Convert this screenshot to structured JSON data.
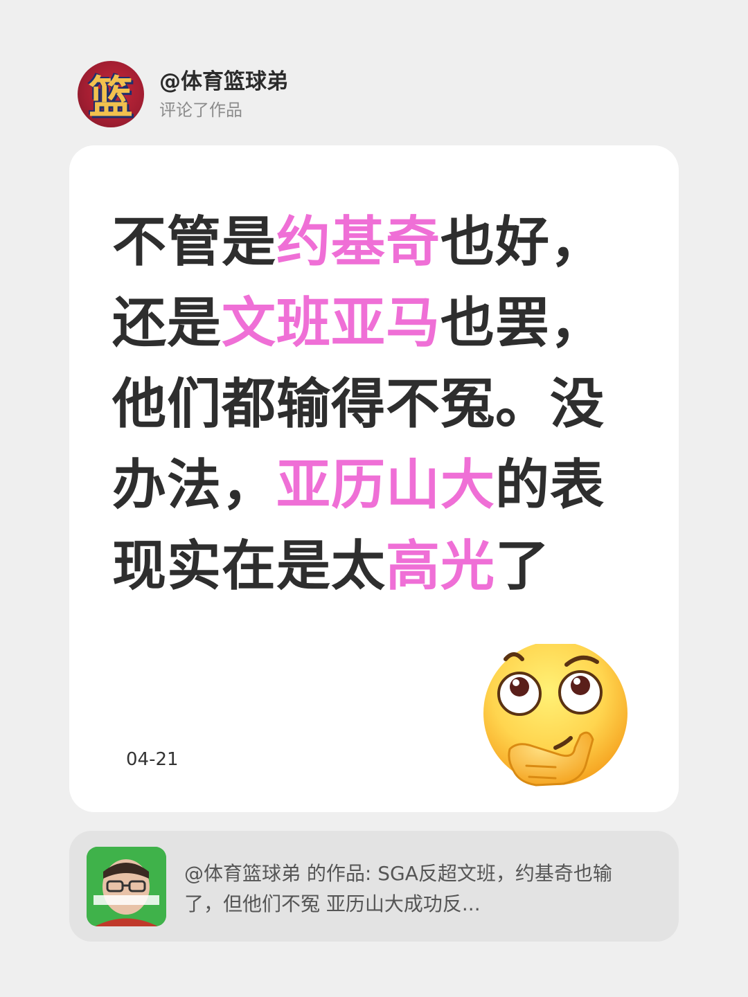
{
  "header": {
    "username": "@体育篮球弟",
    "action": "评论了作品",
    "avatar_glyph": "篮"
  },
  "comment": {
    "segments": [
      {
        "text": "不管是",
        "highlight": false
      },
      {
        "text": "约基奇",
        "highlight": true
      },
      {
        "text": "也好，还是",
        "highlight": false
      },
      {
        "text": "文班亚马",
        "highlight": true
      },
      {
        "text": "也罢，他们都输得不冤。没办法，",
        "highlight": false
      },
      {
        "text": "亚历山大",
        "highlight": true
      },
      {
        "text": "的表现实在是太",
        "highlight": false
      },
      {
        "text": "高光",
        "highlight": true
      },
      {
        "text": "了",
        "highlight": false
      }
    ],
    "highlight_color": "#ef6fd6",
    "text_color": "#2e2e2e"
  },
  "date": "04-21",
  "emoji": "thinking-face-icon",
  "linked_post": {
    "text": "@体育篮球弟  的作品: SGA反超文班，约基奇也输了，但他们不冤 亚历山大成功反..."
  },
  "colors": {
    "background": "#efefef",
    "card": "#ffffff",
    "linked_card": "#e3e3e3"
  }
}
